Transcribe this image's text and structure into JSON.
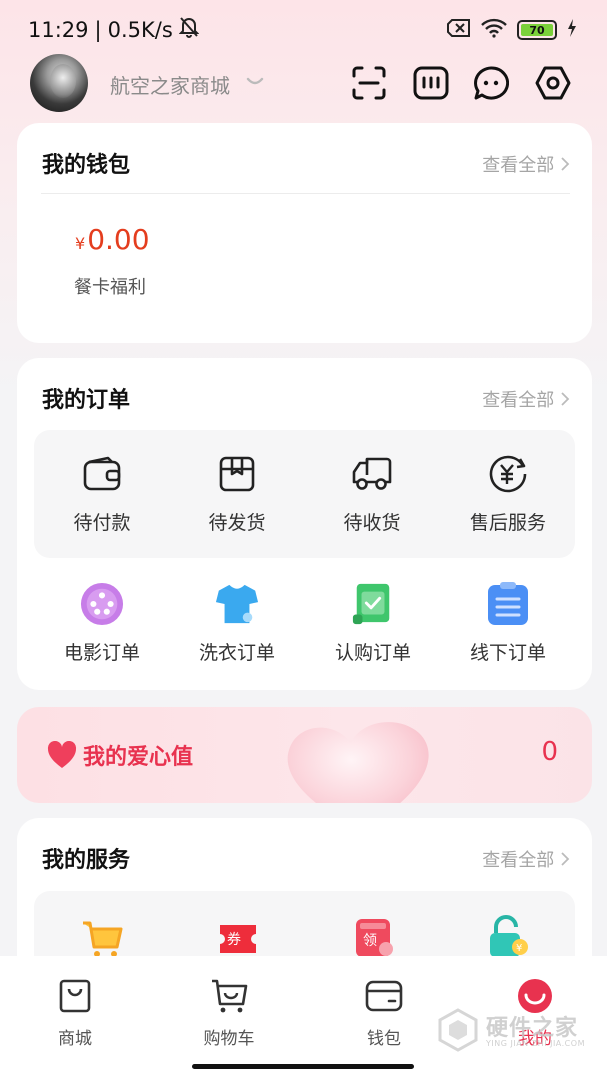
{
  "status_bar": {
    "time": "11:29",
    "separator": "|",
    "speed": "0.5K/s",
    "battery": "70"
  },
  "header": {
    "user_name": "航空之家商城",
    "icons": [
      "scan-icon",
      "keyboard-icon",
      "message-icon",
      "settings-icon"
    ]
  },
  "wallet": {
    "title": "我的钱包",
    "view_all": "查看全部",
    "currency": "¥",
    "amount": "0.00",
    "amount_label": "餐卡福利"
  },
  "orders": {
    "title": "我的订单",
    "view_all": "查看全部",
    "status_items": [
      {
        "label": "待付款",
        "icon": "wallet-icon"
      },
      {
        "label": "待发货",
        "icon": "package-icon"
      },
      {
        "label": "待收货",
        "icon": "truck-icon"
      },
      {
        "label": "售后服务",
        "icon": "refund-icon"
      }
    ],
    "type_items": [
      {
        "label": "电影订单",
        "icon": "film-reel-icon",
        "color": "#c77de8"
      },
      {
        "label": "洗衣订单",
        "icon": "shirt-icon",
        "color": "#3aa9ef"
      },
      {
        "label": "认购订单",
        "icon": "certificate-icon",
        "color": "#3fc66c"
      },
      {
        "label": "线下订单",
        "icon": "clipboard-icon",
        "color": "#4b8ff5"
      }
    ]
  },
  "love": {
    "title": "我的爱心值",
    "value": "0"
  },
  "services": {
    "title": "我的服务",
    "view_all": "查看全部",
    "items": [
      {
        "icon": "cart-icon"
      },
      {
        "icon": "coupon-icon",
        "label": "券"
      },
      {
        "icon": "claim-icon",
        "label": "领"
      },
      {
        "icon": "lock-icon"
      }
    ]
  },
  "bottom_nav": {
    "items": [
      {
        "label": "商城",
        "icon": "shopping-bag-icon"
      },
      {
        "label": "购物车",
        "icon": "cart-icon"
      },
      {
        "label": "钱包",
        "icon": "wallet-icon"
      },
      {
        "label": "我的",
        "icon": "profile-icon",
        "active": true
      }
    ]
  },
  "watermark": {
    "text": "硬件之家",
    "sub": "YING JIAN ZHI JIA.COM"
  },
  "colors": {
    "accent": "#e8324f",
    "amount": "#e43d1e"
  }
}
